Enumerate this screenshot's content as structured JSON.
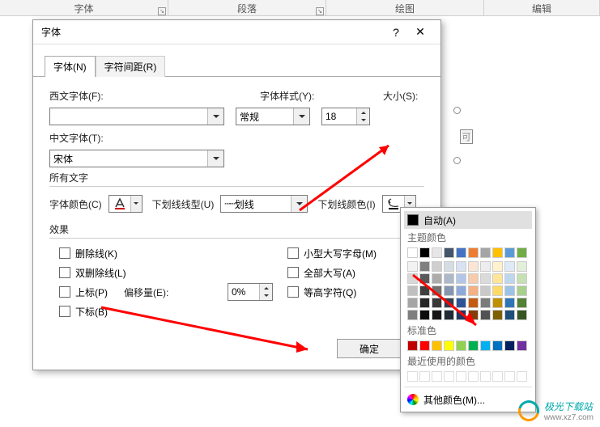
{
  "ribbon": {
    "g1": "字体",
    "g2": "段落",
    "g3": "绘图",
    "g4": "编辑"
  },
  "dialog": {
    "title": "字体",
    "tab_font": "字体(N)",
    "tab_spacing": "字符间距(R)",
    "latin_label": "西文字体(F):",
    "style_label": "字体样式(Y):",
    "style_value": "常规",
    "size_label": "大小(S):",
    "size_value": "18",
    "asian_label": "中文字体(T):",
    "asian_value": "宋体",
    "alltext": "所有文字",
    "fontcolor_label": "字体颜色(C)",
    "underline_label": "下划线线型(U)",
    "underline_value": "划线",
    "underlinecolor_label": "下划线颜色(I)",
    "effects": "效果",
    "strike": "删除线(K)",
    "dstrike": "双删除线(L)",
    "superscript": "上标(P)",
    "subscript": "下标(B)",
    "offset_label": "偏移量(E):",
    "offset_value": "0%",
    "smallcap": "小型大写字母(M)",
    "allcap": "全部大写(A)",
    "equalh": "等高字符(Q)",
    "ok": "确定"
  },
  "colorpanel": {
    "auto": "自动(A)",
    "theme": "主题颜色",
    "standard": "标准色",
    "recent": "最近使用的颜色",
    "more": "其他颜色(M)...",
    "theme_row1": [
      "#ffffff",
      "#000000",
      "#e7e6e6",
      "#44546a",
      "#4472c4",
      "#ed7d31",
      "#a5a5a5",
      "#ffc000",
      "#5b9bd5",
      "#70ad47"
    ],
    "theme_shades": [
      [
        "#f2f2f2",
        "#7f7f7f",
        "#d0cece",
        "#d6dce4",
        "#d9e2f3",
        "#fbe5d5",
        "#ededed",
        "#fff2cc",
        "#deebf6",
        "#e2efd9"
      ],
      [
        "#d8d8d8",
        "#595959",
        "#aeabab",
        "#adb9ca",
        "#b4c6e7",
        "#f7cbac",
        "#dbdbdb",
        "#fee599",
        "#bdd7ee",
        "#c5e0b3"
      ],
      [
        "#bfbfbf",
        "#3f3f3f",
        "#757070",
        "#8496b0",
        "#8eaadb",
        "#f4b183",
        "#c9c9c9",
        "#ffd965",
        "#9cc3e5",
        "#a8d08d"
      ],
      [
        "#a5a5a5",
        "#262626",
        "#3a3838",
        "#323f4f",
        "#2f5496",
        "#c55a11",
        "#7b7b7b",
        "#bf9000",
        "#2e75b5",
        "#538135"
      ],
      [
        "#7f7f7f",
        "#0c0c0c",
        "#171616",
        "#222a35",
        "#1f3864",
        "#833c0b",
        "#525252",
        "#7f6000",
        "#1e4e79",
        "#375623"
      ]
    ],
    "standard_colors": [
      "#c00000",
      "#ff0000",
      "#ffc000",
      "#ffff00",
      "#92d050",
      "#00b050",
      "#00b0f0",
      "#0070c0",
      "#002060",
      "#7030a0"
    ]
  },
  "watermark": {
    "name": "极光下载站",
    "url": "www.xz7.com"
  }
}
